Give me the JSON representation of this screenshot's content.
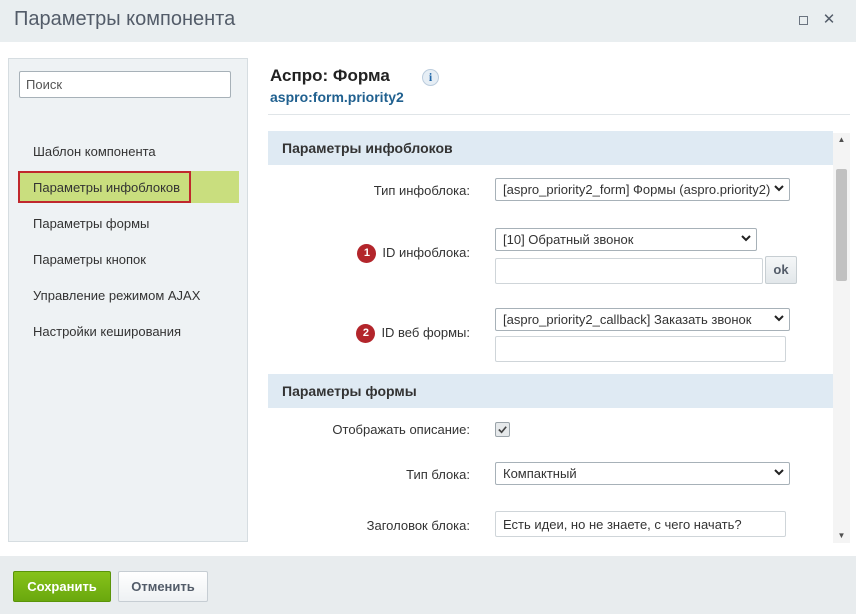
{
  "window": {
    "title": "Параметры компонента"
  },
  "sidebar": {
    "search_placeholder": "Поиск",
    "items": [
      {
        "label": "Шаблон компонента"
      },
      {
        "label": "Параметры инфоблоков"
      },
      {
        "label": "Параметры формы"
      },
      {
        "label": "Параметры кнопок"
      },
      {
        "label": "Управление режимом AJAX"
      },
      {
        "label": "Настройки кеширования"
      }
    ],
    "active_index": 1
  },
  "component": {
    "title": "Аспро: Форма",
    "code": "aspro:form.priority2",
    "info_icon_text": "i"
  },
  "sections": {
    "iblock": {
      "header": "Параметры инфоблоков",
      "type_label": "Тип инфоблока:",
      "type_value": "[aspro_priority2_form] Формы (aspro.priority2)",
      "id_badge": "1",
      "id_label": "ID инфоблока:",
      "id_value": "[10] Обратный звонок",
      "id_input_value": "",
      "ok_label": "ok",
      "web_badge": "2",
      "web_label": "ID веб формы:",
      "web_value": "[aspro_priority2_callback] Заказать звонок",
      "web_input_value": ""
    },
    "form": {
      "header": "Параметры формы",
      "show_desc_label": "Отображать описание:",
      "show_desc_checked": true,
      "block_type_label": "Тип блока:",
      "block_type_value": "Компактный",
      "block_title_label": "Заголовок блока:",
      "block_title_value": "Есть идеи, но не знаете, с чего начать?"
    }
  },
  "footer": {
    "save_label": "Сохранить",
    "cancel_label": "Отменить"
  }
}
